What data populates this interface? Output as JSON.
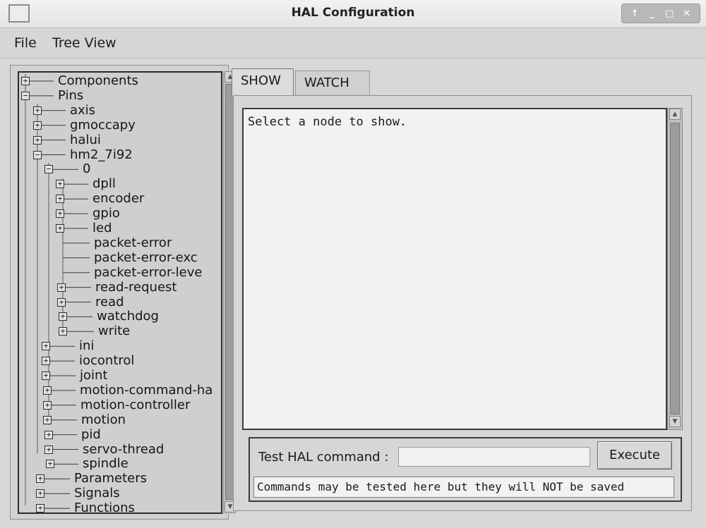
{
  "window": {
    "title": "HAL Configuration"
  },
  "menu": [
    {
      "label": "File"
    },
    {
      "label": "Tree View"
    }
  ],
  "tree": [
    {
      "label": "Components",
      "expander": "plus"
    },
    {
      "label": "Pins",
      "expander": "minus"
    },
    {
      "label": "axis",
      "expander": "plus"
    },
    {
      "label": "gmoccapy",
      "expander": "plus"
    },
    {
      "label": "halui",
      "expander": "plus"
    },
    {
      "label": "hm2_7i92",
      "expander": "minus"
    },
    {
      "label": "0",
      "expander": "minus"
    },
    {
      "label": "dpll",
      "expander": "plus"
    },
    {
      "label": "encoder",
      "expander": "plus"
    },
    {
      "label": "gpio",
      "expander": "plus"
    },
    {
      "label": "led",
      "expander": "plus"
    },
    {
      "label": "packet-error",
      "expander": "none"
    },
    {
      "label": "packet-error-exc",
      "expander": "none"
    },
    {
      "label": "packet-error-leve",
      "expander": "none"
    },
    {
      "label": "read-request",
      "expander": "plus"
    },
    {
      "label": "read",
      "expander": "plus"
    },
    {
      "label": "watchdog",
      "expander": "plus"
    },
    {
      "label": "write",
      "expander": "plus"
    },
    {
      "label": "ini",
      "expander": "plus"
    },
    {
      "label": "iocontrol",
      "expander": "plus"
    },
    {
      "label": "joint",
      "expander": "plus"
    },
    {
      "label": "motion-command-ha",
      "expander": "plus"
    },
    {
      "label": "motion-controller",
      "expander": "plus"
    },
    {
      "label": "motion",
      "expander": "plus"
    },
    {
      "label": "pid",
      "expander": "plus"
    },
    {
      "label": "servo-thread",
      "expander": "plus"
    },
    {
      "label": "spindle",
      "expander": "plus"
    },
    {
      "label": "Parameters",
      "expander": "plus"
    },
    {
      "label": "Signals",
      "expander": "plus"
    },
    {
      "label": "Functions",
      "expander": "plus"
    }
  ],
  "tabs": [
    {
      "label": "SHOW",
      "active": true
    },
    {
      "label": "WATCH",
      "active": false
    }
  ],
  "show": {
    "text": "Select a node to show."
  },
  "command": {
    "label": "Test HAL command :",
    "value": "",
    "execute_label": "Execute",
    "status": "Commands may be tested here but they will NOT be saved"
  }
}
